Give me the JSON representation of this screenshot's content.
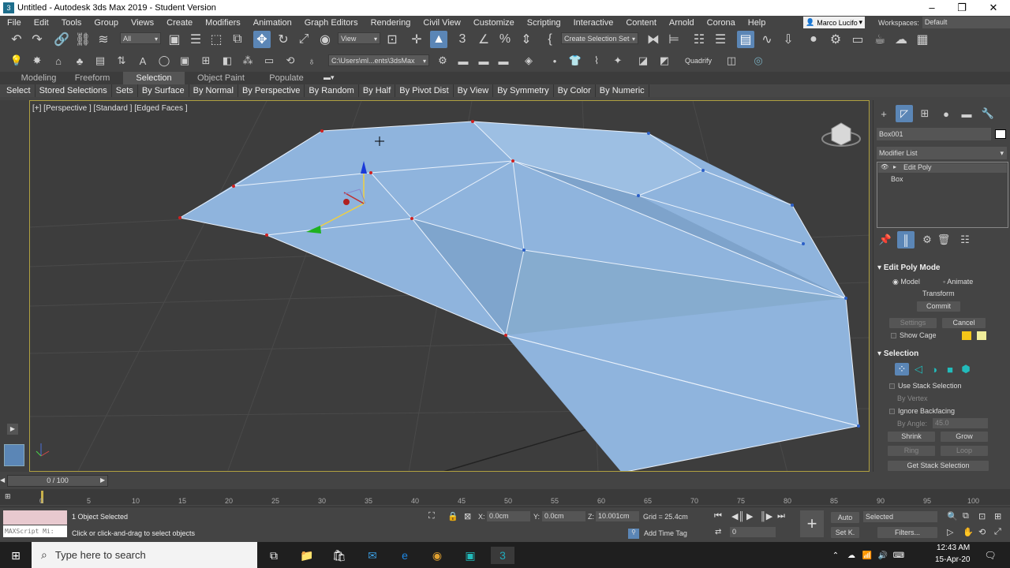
{
  "window": {
    "title": "Untitled - Autodesk 3ds Max 2019 - Student Version"
  },
  "menu": [
    "File",
    "Edit",
    "Tools",
    "Group",
    "Views",
    "Create",
    "Modifiers",
    "Animation",
    "Graph Editors",
    "Rendering",
    "Civil View",
    "Customize",
    "Scripting",
    "Interactive",
    "Content",
    "Arnold",
    "Corona",
    "Help"
  ],
  "user": "Marco Lucifo",
  "workspaces_label": "Workspaces:",
  "workspace": "Default",
  "toolbar": {
    "filter": "All",
    "ref_coord": "View",
    "selection_set": "Create Selection Set",
    "project_path": "C:\\Users\\ml...ents\\3dsMax",
    "quadrify": "Quadrify"
  },
  "ribbon_tabs": [
    "Modeling",
    "Freeform",
    "Selection",
    "Object Paint",
    "Populate"
  ],
  "ribbon_active": "Selection",
  "ribbon_items": [
    "Select",
    "Stored Selections",
    "Sets",
    "By Surface",
    "By Normal",
    "By Perspective",
    "By Random",
    "By Half",
    "By Pivot Dist",
    "By View",
    "By Symmetry",
    "By Color",
    "By Numeric"
  ],
  "viewport": {
    "label": "[+] [Perspective ] [Standard ] [Edged Faces ]"
  },
  "command_panel": {
    "object_name": "Box001",
    "object_color": "#ffffff",
    "modifier_list": "Modifier List",
    "stack": [
      "Edit Poly",
      "Box"
    ],
    "edit_poly_mode": {
      "header": "Edit Poly Mode",
      "model": "Model",
      "animate": "Animate",
      "transform": "Transform",
      "commit": "Commit",
      "settings": "Settings",
      "cancel": "Cancel",
      "show_cage": "Show Cage"
    },
    "selection": {
      "header": "Selection",
      "use_stack": "Use Stack Selection",
      "by_vertex": "By Vertex",
      "ignore_backfacing": "Ignore Backfacing",
      "by_angle": "By Angle:",
      "angle_value": "45.0",
      "shrink": "Shrink",
      "grow": "Grow",
      "ring": "Ring",
      "loop": "Loop",
      "get_stack": "Get Stack Selection"
    }
  },
  "timeline": {
    "frame": "0 / 100",
    "ticks": [
      "0",
      "5",
      "10",
      "15",
      "20",
      "25",
      "30",
      "35",
      "40",
      "45",
      "50",
      "55",
      "60",
      "65",
      "70",
      "75",
      "80",
      "85",
      "90",
      "95",
      "100"
    ]
  },
  "status": {
    "maxscript": "MAXScript Mi:",
    "selected": "1 Object Selected",
    "prompt": "Click or click-and-drag to select objects",
    "x_label": "X:",
    "x": "0.0cm",
    "y_label": "Y:",
    "y": "0.0cm",
    "z_label": "Z:",
    "z": "10.001cm",
    "grid": "Grid = 25.4cm",
    "add_time_tag": "Add Time Tag",
    "auto": "Auto",
    "set_k": "Set K.",
    "selected_mode": "Selected",
    "filters": "Filters...",
    "frame_field": "0"
  },
  "taskbar": {
    "search": "Type here to search",
    "time": "12:43 AM",
    "date": "15-Apr-20"
  },
  "colors": {
    "accent": "#5b86b6",
    "viewport_bg": "#3d3d3d",
    "mesh": "#8fb4dd"
  }
}
